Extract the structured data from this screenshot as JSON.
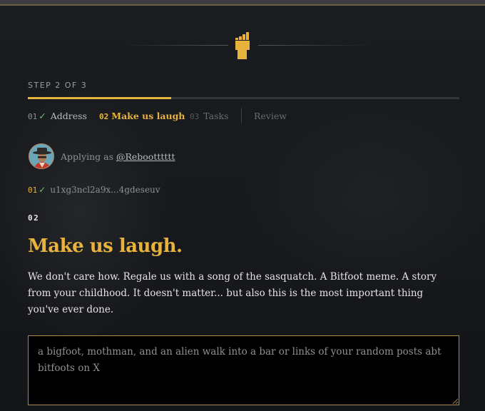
{
  "progress": {
    "label": "STEP 2 OF 3",
    "fraction": 0.333
  },
  "steps": [
    {
      "num": "01",
      "check": "✓",
      "label": "Address",
      "status": "done"
    },
    {
      "num": "02",
      "label": "Make us laugh",
      "status": "active"
    },
    {
      "num": "03",
      "label": "Tasks",
      "status": "upcoming"
    },
    {
      "label": "Review",
      "status": "upcoming"
    }
  ],
  "applicant": {
    "prefix": "Applying as",
    "handle": "@Rebootttttt"
  },
  "address_summary": {
    "num": "01",
    "check": "✓",
    "value": "u1xg3ncl2a9x...4gdeseuv"
  },
  "section": {
    "num": "02",
    "title": "Make us laugh.",
    "description": "We don't care how. Regale us with a song of the sasquatch. A Bitfoot meme. A story from your childhood. It doesn't matter... but also this is the most important thing you've ever done."
  },
  "input": {
    "value": "",
    "placeholder": "a bigfoot, mothman, and an alien walk into a bar or links of your random posts abt bitfoots on X"
  },
  "colors": {
    "accent": "#e8b33c",
    "check": "#6fbf73",
    "background": "#15171b"
  },
  "icons": [
    "bitfoot-logo-icon",
    "avatar",
    "check-icon",
    "resize-grip-icon"
  ]
}
